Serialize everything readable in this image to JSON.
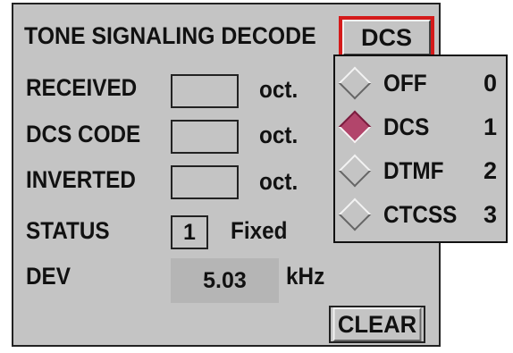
{
  "panel": {
    "title": "TONE SIGNALING DECODE",
    "mode_button_label": "DCS",
    "rows": {
      "received_label": "RECEIVED",
      "received_unit": "oct.",
      "dcs_code_label": "DCS CODE",
      "dcs_code_unit": "oct.",
      "inverted_label": "INVERTED",
      "inverted_unit": "oct.",
      "status_label": "STATUS",
      "status_value": "1",
      "status_text": "Fixed",
      "dev_label": "DEV",
      "dev_value": "5.03",
      "dev_unit": "kHz"
    },
    "clear_label": "CLEAR"
  },
  "dropdown": {
    "selected_index": 1,
    "options": [
      {
        "label": "OFF",
        "num": "0"
      },
      {
        "label": "DCS",
        "num": "1"
      },
      {
        "label": "DTMF",
        "num": "2"
      },
      {
        "label": "CTCSS",
        "num": "3"
      }
    ]
  },
  "colors": {
    "panel_bg": "#c4c4c4",
    "focus_border": "#d41a1a",
    "selected_radio": "#b2456b"
  }
}
